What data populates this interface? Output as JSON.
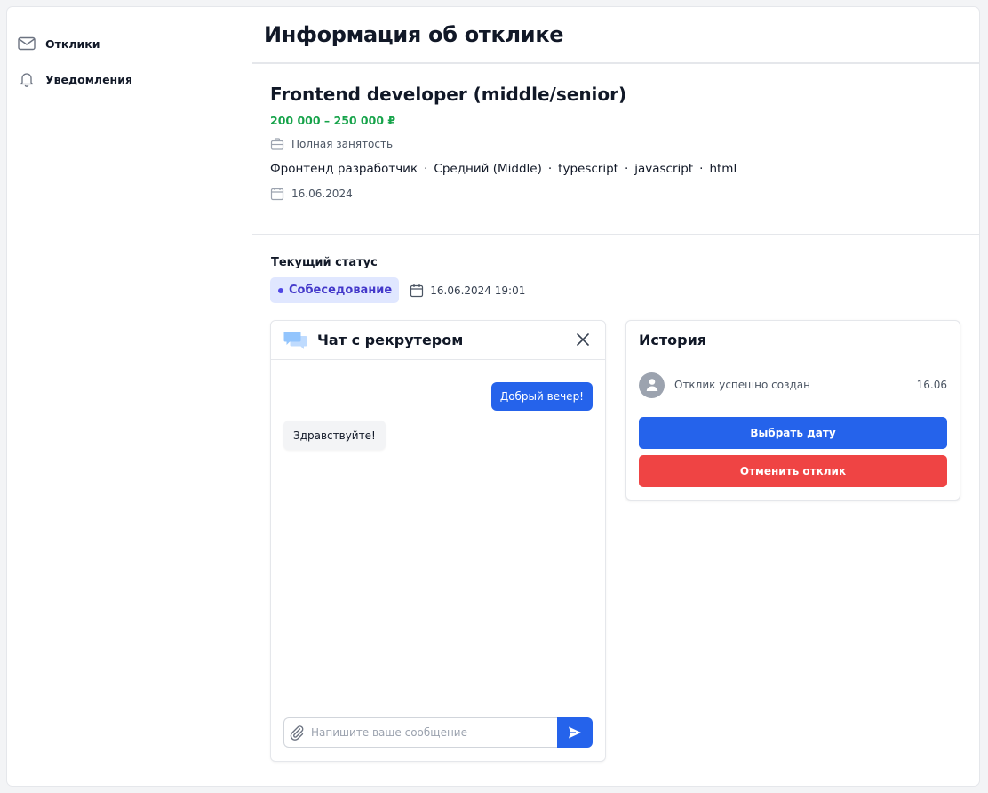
{
  "sidebar": {
    "items": [
      {
        "label": "Отклики",
        "icon": "mail-icon"
      },
      {
        "label": "Уведомления",
        "icon": "bell-icon"
      }
    ]
  },
  "page": {
    "title": "Информация об отклике"
  },
  "vacancy": {
    "title": "Frontend developer (middle/senior)",
    "salary": "200 000 – 250 000 ₽",
    "employment": "Полная занятость",
    "tags": [
      "Фронтенд разработчик",
      "Средний (Middle)",
      "typescript",
      "javascript",
      "html"
    ],
    "tag_separator": "·",
    "date": "16.06.2024"
  },
  "status": {
    "title": "Текущий статус",
    "badge": "Собеседование",
    "datetime": "16.06.2024 19:01"
  },
  "chat": {
    "title": "Чат с рекрутером",
    "messages": {
      "outgoing": "Добрый вечер!",
      "incoming": "Здравствуйте!"
    },
    "input_placeholder": "Напишите ваше сообщение",
    "input_value": ""
  },
  "history": {
    "title": "История",
    "item_text": "Отклик успешно создан",
    "item_date": "16.06",
    "choose_date_label": "Выбрать дату",
    "cancel_label": "Отменить отклик"
  },
  "colors": {
    "accent": "#2563eb",
    "danger": "#ef4444",
    "salary": "#16a34a",
    "status_bg": "#e0e7ff",
    "status_text": "#4338ca"
  }
}
